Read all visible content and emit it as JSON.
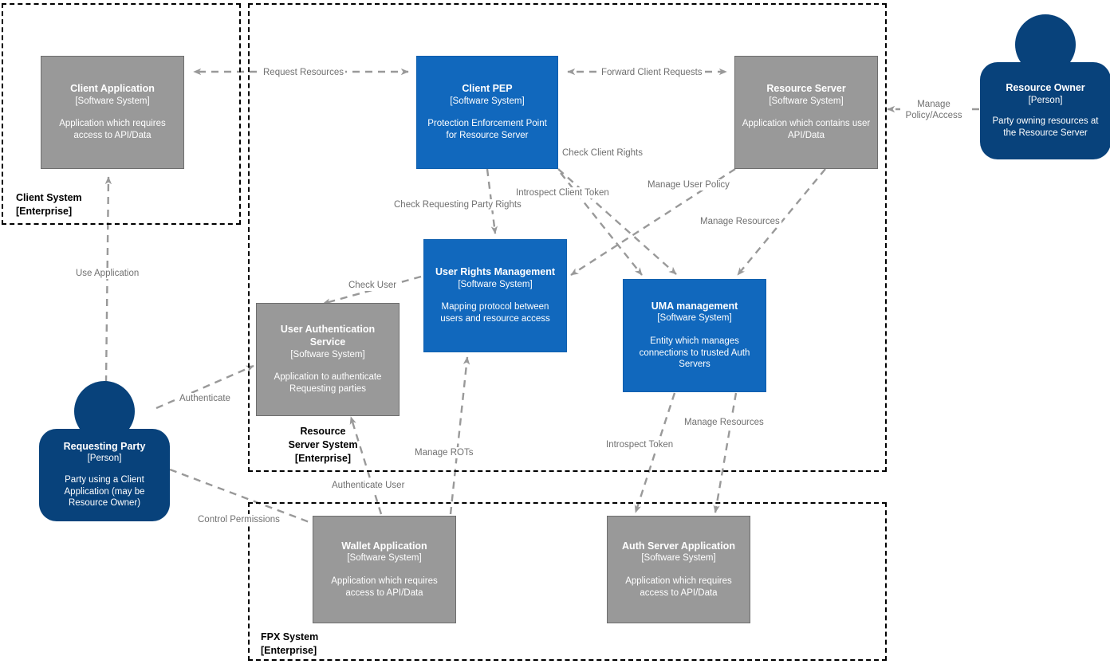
{
  "diagram": {
    "type": "C4 System Landscape",
    "colors": {
      "software_system_external": "#999999",
      "software_system_internal": "#1168bd",
      "person": "#08427b",
      "boundary": "#000000",
      "relationship": "#999999",
      "relationship_label": "#707070"
    }
  },
  "boundaries": [
    {
      "id": "client-system",
      "name": "Client System",
      "type": "[Enterprise]"
    },
    {
      "id": "resource-server-system",
      "name": "Resource\nServer System",
      "name_line1": "Resource",
      "name_line2": "Server System",
      "type": "[Enterprise]"
    },
    {
      "id": "fpx-system",
      "name": "FPX System",
      "type": "[Enterprise]"
    }
  ],
  "nodes": [
    {
      "id": "client-application",
      "name": "Client Application",
      "type": "[Software System]",
      "description": "Application which requires access to API/Data",
      "style": "gray"
    },
    {
      "id": "client-pep",
      "name": "Client PEP",
      "type": "[Software System]",
      "description": "Protection Enforcement Point for Resource Server",
      "style": "blue"
    },
    {
      "id": "resource-server",
      "name": "Resource Server",
      "type": "[Software System]",
      "description": "Application which contains user API/Data",
      "style": "gray"
    },
    {
      "id": "user-authentication-service",
      "name": "User Authentication Service",
      "type": "[Software System]",
      "description": "Application to authenticate Requesting parties",
      "style": "gray"
    },
    {
      "id": "user-rights-management",
      "name": "User Rights Management",
      "type": "[Software System]",
      "description": "Mapping protocol between users and resource access",
      "style": "blue"
    },
    {
      "id": "uma-management",
      "name": "UMA management",
      "type": "[Software System]",
      "description": "Entity which manages connections to trusted Auth Servers",
      "style": "blue"
    },
    {
      "id": "wallet-application",
      "name": "Wallet Application",
      "type": "[Software System]",
      "description": "Application which requires access to API/Data",
      "style": "gray"
    },
    {
      "id": "auth-server-application",
      "name": "Auth Server Application",
      "type": "[Software System]",
      "description": "Application which requires access to API/Data",
      "style": "gray"
    }
  ],
  "people": [
    {
      "id": "resource-owner",
      "name": "Resource Owner",
      "type": "[Person]",
      "description": "Party owning resources at the Resource Server"
    },
    {
      "id": "requesting-party",
      "name": "Requesting Party",
      "type": "[Person]",
      "description": "Party using a Client Application (may be Resource Owner)"
    }
  ],
  "relationships": [
    {
      "id": "request-resources",
      "label": "Request Resources",
      "from": "client-application",
      "to": "client-pep",
      "bidirectional": true
    },
    {
      "id": "forward-client-requests",
      "label": "Forward Client Requests",
      "from": "client-pep",
      "to": "resource-server",
      "bidirectional": true
    },
    {
      "id": "manage-policy-access",
      "label": "Manage Policy/Access",
      "label_line1": "Manage",
      "label_line2": "Policy/Access",
      "from": "resource-owner",
      "to": "resource-server",
      "bidirectional": false
    },
    {
      "id": "use-application",
      "label": "Use Application",
      "from": "requesting-party",
      "to": "client-application",
      "bidirectional": false
    },
    {
      "id": "check-requesting-party-rights",
      "label": "Check Requesting Party Rights",
      "from": "client-pep",
      "to": "user-rights-management",
      "bidirectional": false
    },
    {
      "id": "check-client-rights",
      "label": "Check Client Rights",
      "from": "client-pep",
      "to": "uma-management",
      "bidirectional": false
    },
    {
      "id": "introspect-client-token",
      "label": "Introspect Client Token",
      "from": "client-pep",
      "to": "uma-management",
      "bidirectional": false
    },
    {
      "id": "manage-user-policy",
      "label": "Manage User Policy",
      "from": "resource-server",
      "to": "user-rights-management",
      "bidirectional": false
    },
    {
      "id": "manage-resources-rs",
      "label": "Manage Resources",
      "from": "resource-server",
      "to": "uma-management",
      "bidirectional": false
    },
    {
      "id": "check-user",
      "label": "Check User",
      "from": "user-rights-management",
      "to": "user-authentication-service",
      "bidirectional": false
    },
    {
      "id": "authenticate",
      "label": "Authenticate",
      "from": "requesting-party",
      "to": "user-authentication-service",
      "bidirectional": false
    },
    {
      "id": "authenticate-user",
      "label": "Authenticate User",
      "from": "wallet-application",
      "to": "user-authentication-service",
      "bidirectional": false
    },
    {
      "id": "manage-rots",
      "label": "Manage ROTs",
      "from": "wallet-application",
      "to": "user-rights-management",
      "bidirectional": false
    },
    {
      "id": "control-permissions",
      "label": "Control Permissions",
      "from": "requesting-party",
      "to": "wallet-application",
      "bidirectional": false
    },
    {
      "id": "introspect-token",
      "label": "Introspect Token",
      "from": "uma-management",
      "to": "auth-server-application",
      "bidirectional": false
    },
    {
      "id": "manage-resources-uma",
      "label": "Manage Resources",
      "from": "uma-management",
      "to": "auth-server-application",
      "bidirectional": false
    }
  ]
}
